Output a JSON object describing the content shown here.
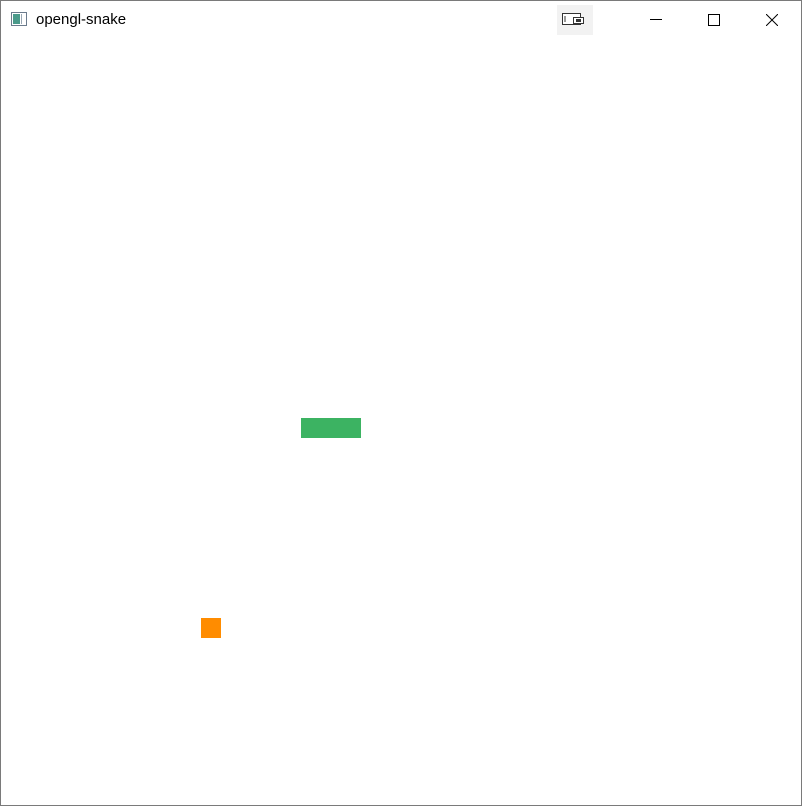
{
  "window": {
    "title": "opengl-snake",
    "icon": "opengl-app-icon",
    "controls": {
      "pip_icon": "picture-in-picture-icon",
      "minimize_icon": "minimize-icon",
      "maximize_icon": "maximize-icon",
      "close_icon": "close-icon"
    }
  },
  "game": {
    "snake": {
      "color": "#3cb362",
      "segments": 3
    },
    "food": {
      "color": "#ff8c00"
    },
    "background_color": "#ffffff"
  }
}
